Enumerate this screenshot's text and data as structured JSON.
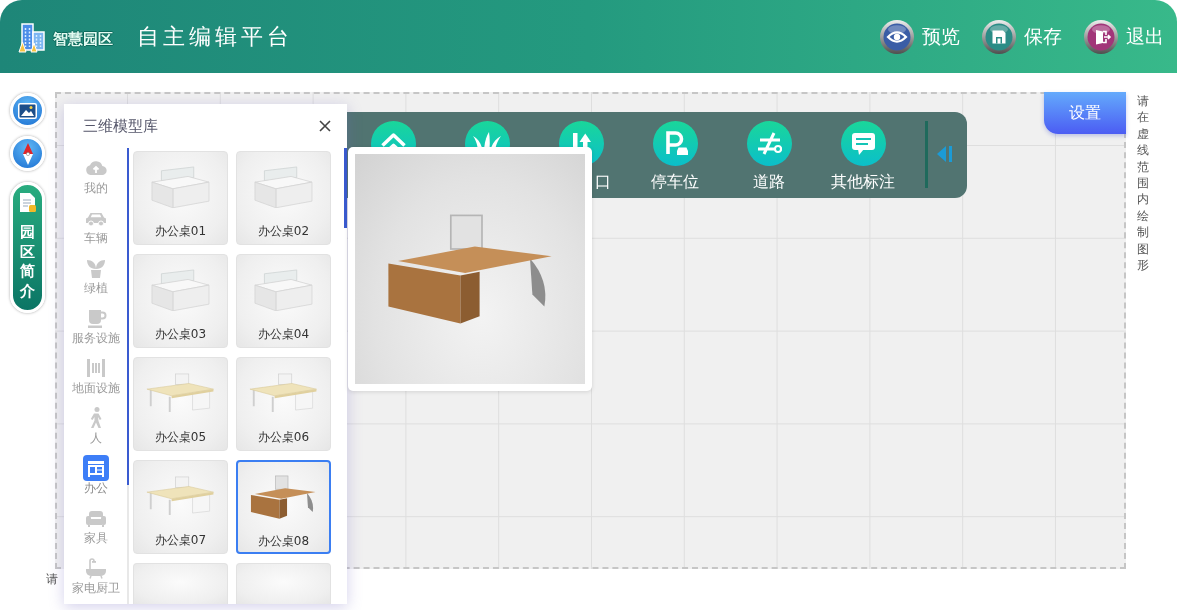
{
  "header": {
    "logo_text": "智慧园区",
    "title": "自主编辑平台",
    "actions": [
      {
        "kind": "preview",
        "label": "预览"
      },
      {
        "kind": "save",
        "label": "保存"
      },
      {
        "kind": "exit",
        "label": "退出"
      }
    ]
  },
  "side_panel": {
    "intro_button": "园区简介"
  },
  "canvas": {
    "settings_button": "设置",
    "hint_vertical": "请在虚线范围内绘制图形",
    "hint_bottom": "请"
  },
  "toolbar": {
    "items": [
      {
        "kind": "building"
      },
      {
        "kind": "plant"
      },
      {
        "kind": "entrance",
        "label": "口"
      },
      {
        "kind": "parking",
        "label": "停车位"
      },
      {
        "kind": "road",
        "label": "道路"
      },
      {
        "kind": "annotation",
        "label": "其他标注"
      }
    ]
  },
  "model_library": {
    "title": "三维模型库",
    "categories": [
      {
        "kind": "upload",
        "label": "我的",
        "selected": false
      },
      {
        "kind": "vehicle",
        "label": "车辆",
        "selected": false
      },
      {
        "kind": "plant",
        "label": "绿植",
        "selected": false
      },
      {
        "kind": "service",
        "label": "服务设施",
        "selected": false
      },
      {
        "kind": "ground",
        "label": "地面设施",
        "selected": false
      },
      {
        "kind": "person",
        "label": "人",
        "selected": false
      },
      {
        "kind": "office",
        "label": "办公",
        "selected": true
      },
      {
        "kind": "furniture",
        "label": "家具",
        "selected": false
      },
      {
        "kind": "bath",
        "label": "家电厨卫",
        "selected": false
      }
    ],
    "models": [
      {
        "kind": "panel",
        "label": "办公桌01",
        "selected": false
      },
      {
        "kind": "panel",
        "label": "办公桌02",
        "selected": false
      },
      {
        "kind": "panel",
        "label": "办公桌03",
        "selected": false
      },
      {
        "kind": "panel",
        "label": "办公桌04",
        "selected": false
      },
      {
        "kind": "maple",
        "label": "办公桌05",
        "selected": false
      },
      {
        "kind": "maple",
        "label": "办公桌06",
        "selected": false
      },
      {
        "kind": "maple",
        "label": "办公桌07",
        "selected": false
      },
      {
        "kind": "walnut",
        "label": "办公桌08",
        "selected": true
      },
      {
        "selected": false
      },
      {
        "selected": false
      }
    ]
  }
}
